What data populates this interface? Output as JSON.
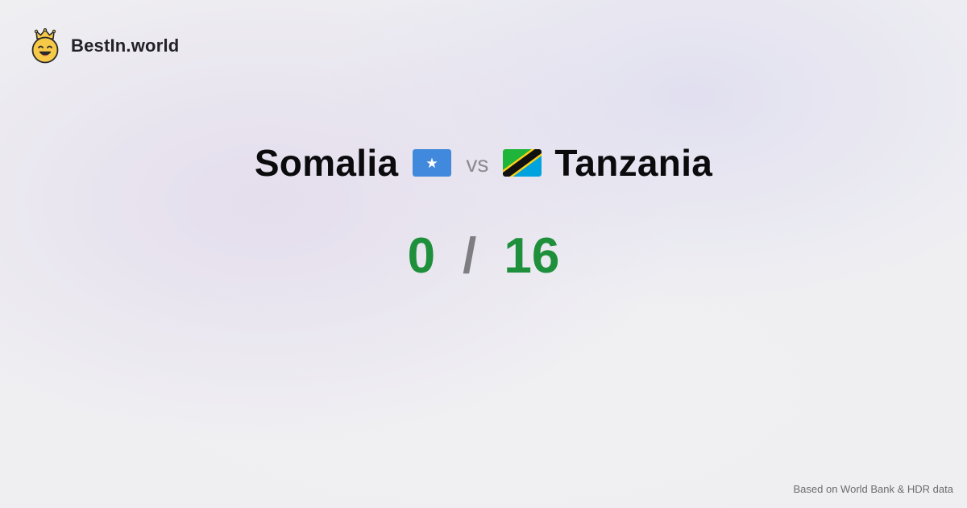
{
  "brand": {
    "name": "BestIn.world",
    "logo_icon": "smiling-king-crown-icon"
  },
  "comparison": {
    "country_a": {
      "name": "Somalia",
      "flag_icon": "somalia-flag-icon"
    },
    "vs_label": "vs",
    "country_b": {
      "name": "Tanzania",
      "flag_icon": "tanzania-flag-icon"
    }
  },
  "score": {
    "country_a": "0",
    "separator": "/",
    "country_b": "16"
  },
  "footer": {
    "source": "Based on World Bank & HDR data"
  },
  "colors": {
    "background": "#efeff2",
    "score_green": "#1e8f3a",
    "separator_gray": "#7e7e82",
    "vs_gray": "#8b8b8f",
    "logo_yellow": "#f7c948",
    "somalia_blue": "#4189dd",
    "tanzania_green": "#1eb53a",
    "tanzania_blue": "#00a3dd"
  }
}
